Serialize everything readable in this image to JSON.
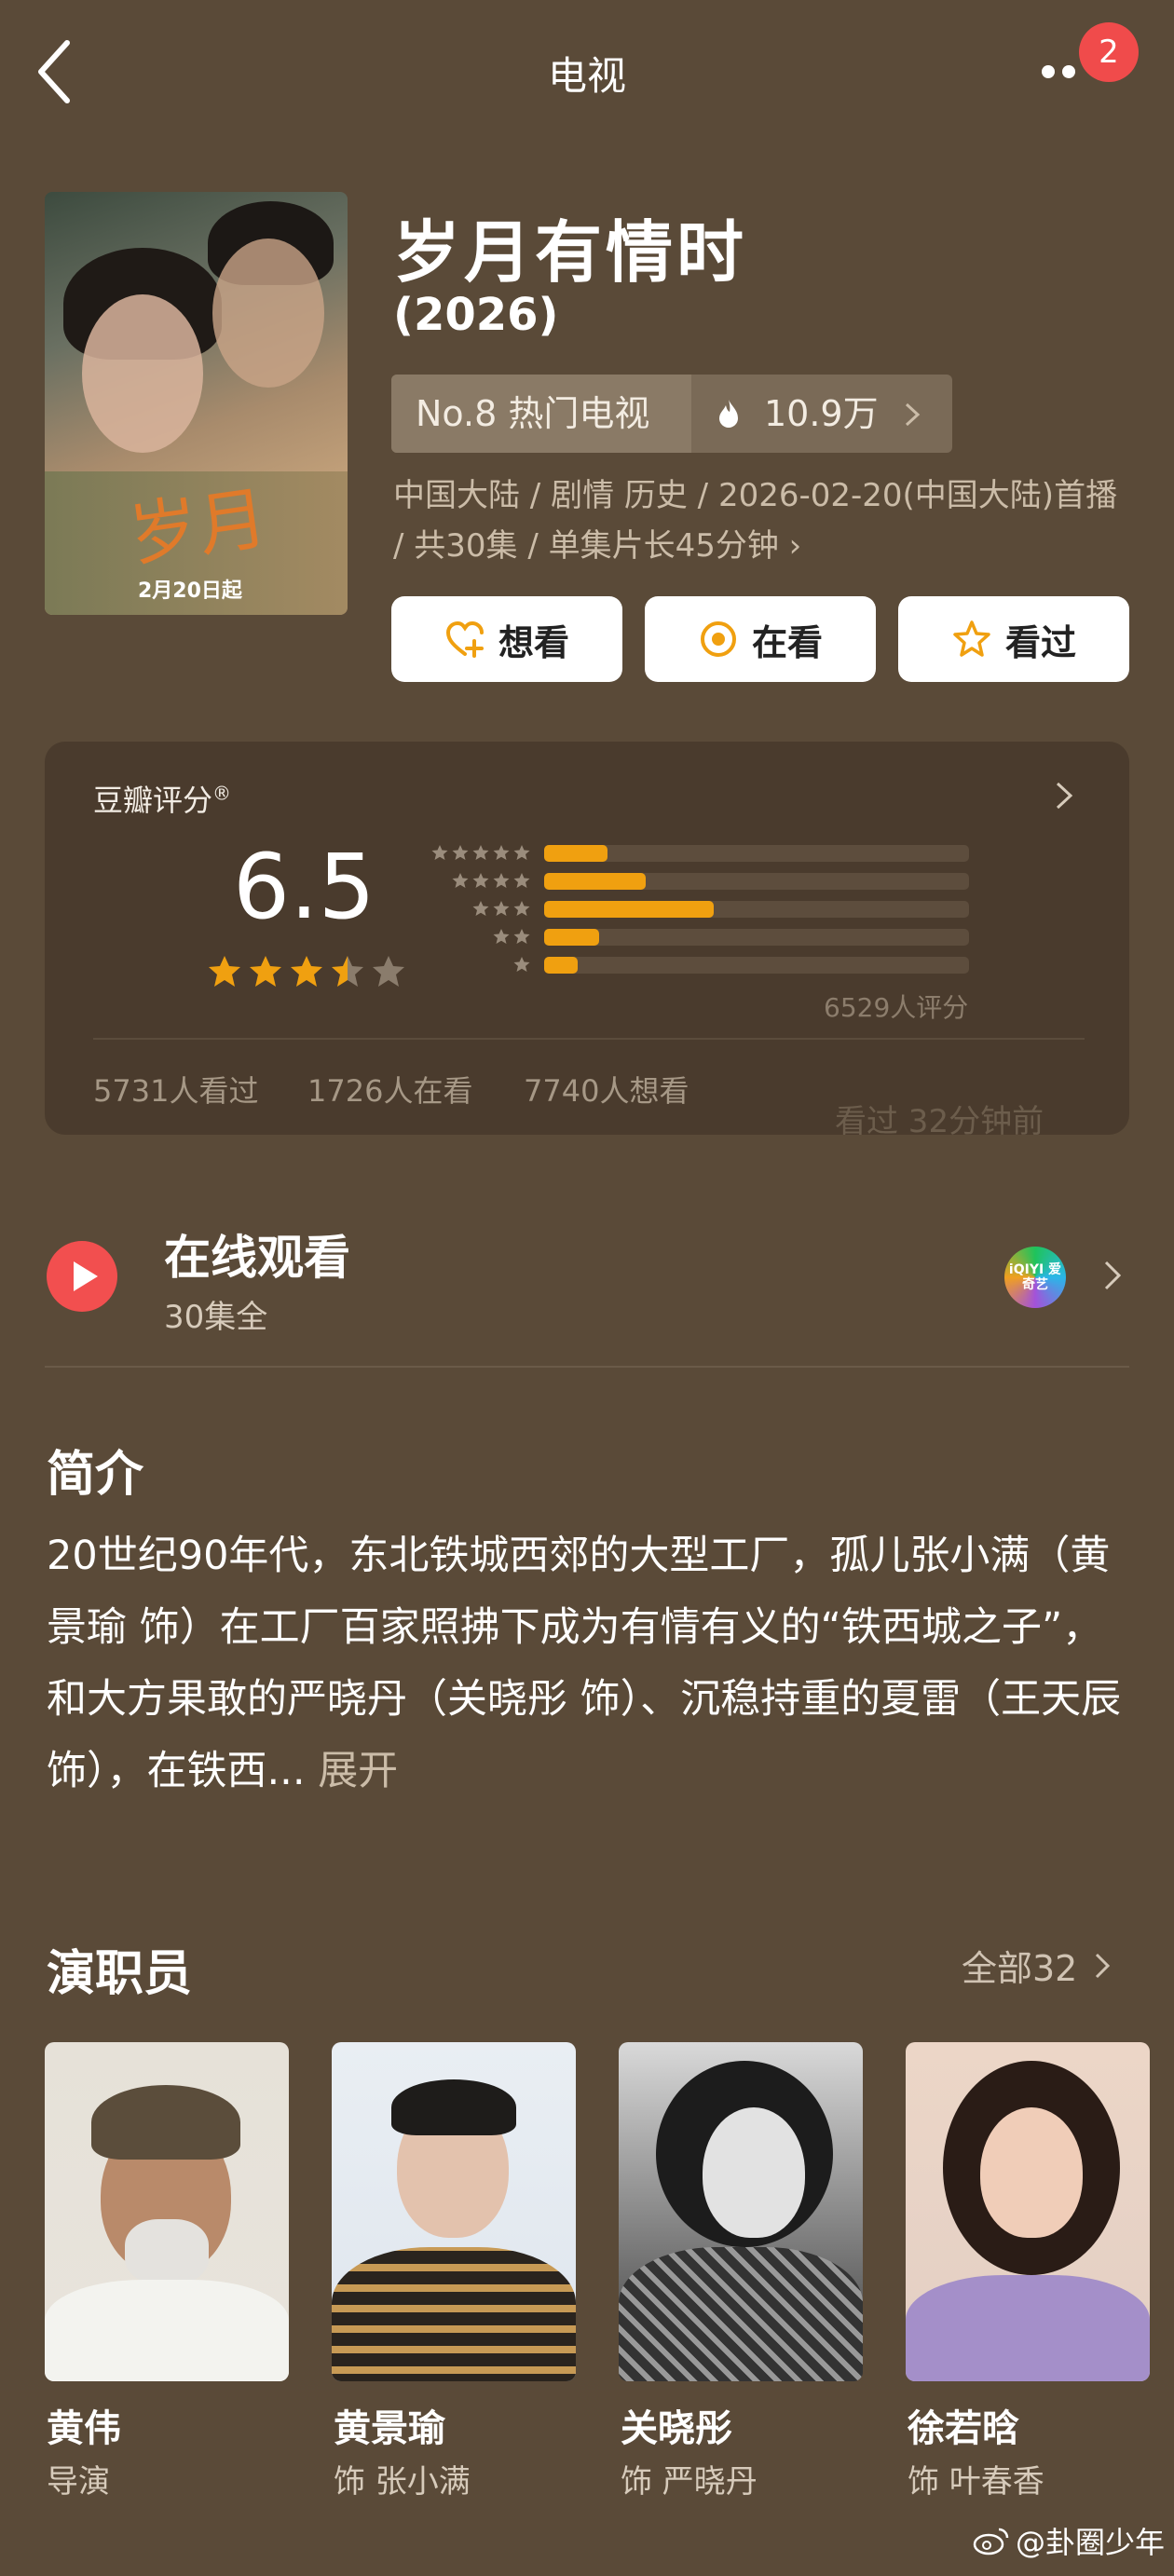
{
  "nav": {
    "title": "电视",
    "badge": "2"
  },
  "poster": {
    "calligraphy": "岁月",
    "date_chip": "2月20日起"
  },
  "show": {
    "title": "岁月有情时",
    "year": "(2026)",
    "rank": "No.8 热门电视",
    "heat": "10.9万",
    "meta": "中国大陆 / 剧情 历史 / 2026-02-20(中国大陆)首播 / 共30集 / 单集片长45分钟 ›"
  },
  "actions": {
    "want": "想看",
    "watching": "在看",
    "watched": "看过"
  },
  "rating": {
    "title": "豆瓣评分",
    "title_mark": "®",
    "score": "6.5",
    "stars": 3.5,
    "distribution": [
      0.15,
      0.24,
      0.4,
      0.13,
      0.08
    ],
    "count": "6529人评分",
    "watched": "5731人看过",
    "watching": "1726人在看",
    "want": "7740人想看",
    "watermark": "看过 32分钟前"
  },
  "online": {
    "title": "在线观看",
    "sub": "30集全",
    "platform_label": "iQIYI 爱奇艺"
  },
  "intro": {
    "title": "简介",
    "text": "20世纪90年代，东北铁城西郊的大型工厂，孤儿张小满（黄景瑜 饰）在工厂百家照拂下成为有情有义的“铁西城之子”，和大方果敢的严晓丹（关晓彤 饰）、沉稳持重的夏雷（王天辰 饰），在铁西...",
    "expand": "展开"
  },
  "cast": {
    "title": "演职员",
    "all": "全部32",
    "members": [
      {
        "name": "黄伟",
        "role": "导演"
      },
      {
        "name": "黄景瑜",
        "role": "饰 张小满"
      },
      {
        "name": "关晓彤",
        "role": "饰 严晓丹"
      },
      {
        "name": "徐若晗",
        "role": "饰 叶春香"
      }
    ]
  },
  "watermark": "@卦圈少年",
  "colors": {
    "background": "#5a4a38",
    "accent": "#f0a010",
    "play": "#f24f4f",
    "badge": "#f04b4b"
  }
}
